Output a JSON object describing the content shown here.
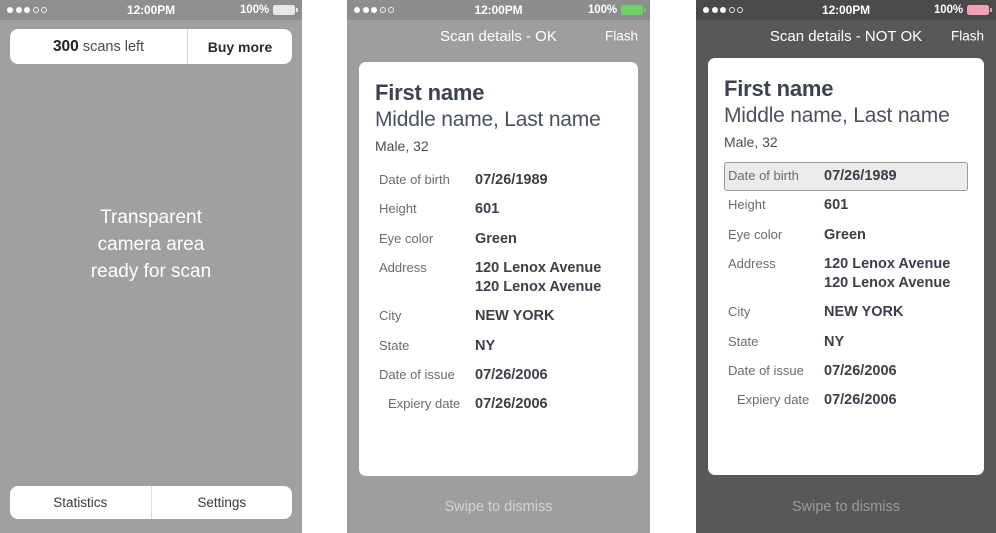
{
  "statusbar": {
    "time": "12:00PM",
    "battery_percent": "100%",
    "signal_dots_filled": 3,
    "signal_dots_total": 5,
    "battery_color_ok": "#6fd06a",
    "battery_color_scan": "#e8e8e8",
    "battery_color_notok": "#f4a0b4"
  },
  "scan_screen": {
    "scans_count": "300",
    "scans_label": "scans left",
    "buy_more_label": "Buy more",
    "camera_line1": "Transparent",
    "camera_line2": "camera area",
    "camera_line3": "ready for scan",
    "statistics_label": "Statistics",
    "settings_label": "Settings"
  },
  "details_ok": {
    "nav_title": "Scan details - OK",
    "flash_label": "Flash",
    "first_name": "First name",
    "other_names": "Middle name, Last name",
    "sub_line": "Male, 32",
    "swipe_label": "Swipe to dismiss",
    "fields": [
      {
        "label": "Date of birth",
        "value": "07/26/1989"
      },
      {
        "label": "Height",
        "value": "601"
      },
      {
        "label": "Eye color",
        "value": "Green"
      },
      {
        "label": "Address",
        "value": "120 Lenox Avenue\n120 Lenox Avenue"
      },
      {
        "label": "City",
        "value": "NEW YORK"
      },
      {
        "label": "State",
        "value": "NY"
      },
      {
        "label": "Date of issue",
        "value": "07/26/2006"
      },
      {
        "label": "Expiery date",
        "value": "07/26/2006"
      }
    ]
  },
  "details_notok": {
    "nav_title": "Scan details - NOT OK",
    "flash_label": "Flash",
    "first_name": "First name",
    "other_names": "Middle name, Last name",
    "sub_line": "Male, 32",
    "swipe_label": "Swipe to dismiss",
    "fields": [
      {
        "label": "Date of birth",
        "value": "07/26/1989",
        "highlighted": true
      },
      {
        "label": "Height",
        "value": "601"
      },
      {
        "label": "Eye color",
        "value": "Green"
      },
      {
        "label": "Address",
        "value": "120 Lenox Avenue\n120 Lenox Avenue"
      },
      {
        "label": "City",
        "value": "NEW YORK"
      },
      {
        "label": "State",
        "value": "NY"
      },
      {
        "label": "Date of issue",
        "value": "07/26/2006"
      },
      {
        "label": "Expiery date",
        "value": "07/26/2006"
      }
    ]
  }
}
